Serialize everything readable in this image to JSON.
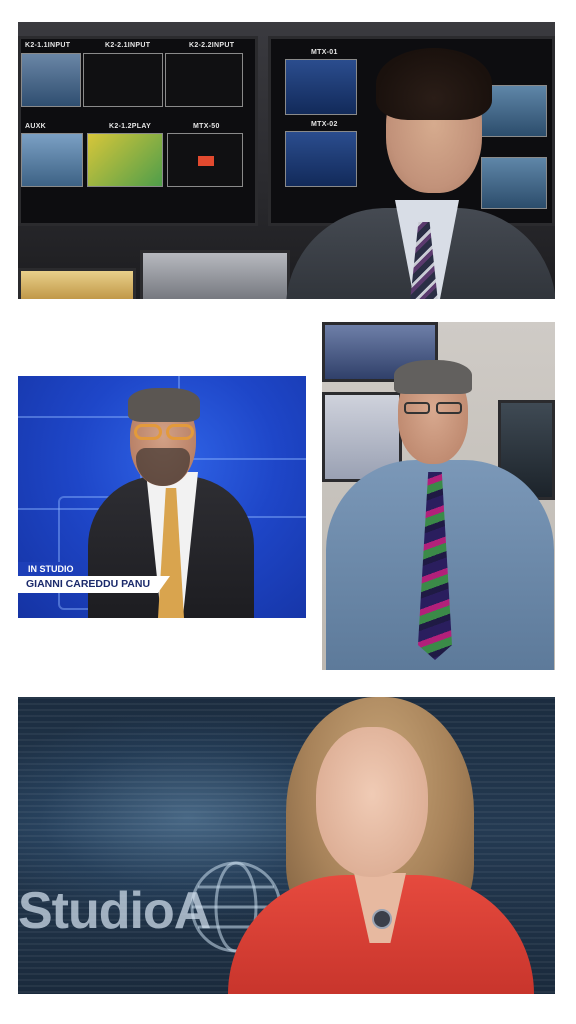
{
  "photos": [
    {
      "id": "control-room",
      "monitor_labels": [
        "K2-1.1INPUT",
        "K2-2.1INPUT",
        "K2-2.2INPUT",
        "AUXK",
        "K2-1.2PLAY",
        "MTX-50",
        "MTX-01",
        "MTX-02"
      ]
    },
    {
      "id": "blue-studio",
      "lower_third": {
        "tag": "IN STUDIO",
        "name": "GIANNI CAREDDU PANU"
      }
    },
    {
      "id": "office-monitors"
    },
    {
      "id": "studioa-set",
      "logo_text": "StudioA"
    }
  ],
  "colors": {
    "studio_blue": "#1e46c8",
    "lower_third_navy": "#1d3fb8",
    "jacket_red": "#d63f35"
  }
}
